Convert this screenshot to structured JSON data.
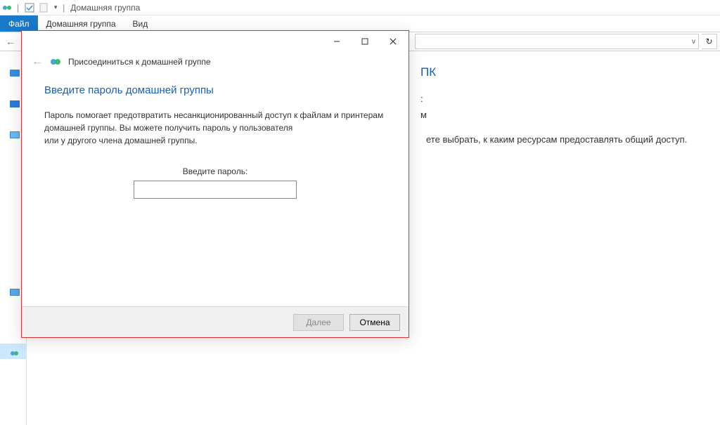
{
  "titlebar": {
    "app_title": "Домашняя группа"
  },
  "ribbon": {
    "file": "Файл",
    "homegroup": "Домашняя группа",
    "view": "Вид"
  },
  "background": {
    "heading_suffix": "ПК",
    "line1_suffix": ":",
    "line2_suffix": "м",
    "desc_suffix": "ете выбрать, к каким ресурсам предоставлять общий доступ."
  },
  "dialog": {
    "app_title": "Присоединиться к домашней группе",
    "heading": "Введите пароль домашней группы",
    "text_line1": "Пароль помогает предотвратить несанкционированный доступ к файлам и принтерам",
    "text_line2": "домашней группы. Вы можете получить пароль у пользователя",
    "text_line3": "или у другого члена домашней группы.",
    "input_label": "Введите пароль:",
    "input_value": "",
    "btn_next": "Далее",
    "btn_cancel": "Отмена"
  }
}
